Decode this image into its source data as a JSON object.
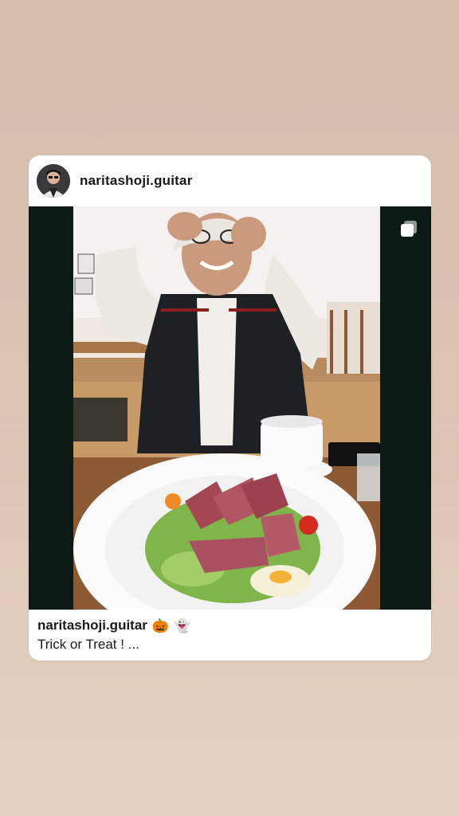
{
  "post": {
    "username": "naritashoji.guitar",
    "caption": {
      "username": "naritashoji.guitar",
      "emojis": [
        "🎃",
        "👻"
      ],
      "text": "Trick or Treat ! ..."
    },
    "icons": {
      "avatar": "profile-avatar",
      "multi": "multiple-images-icon"
    },
    "colors": {
      "card": "#ffffff",
      "media_bg": "#0b1a14",
      "background": "#dcc4b3"
    }
  }
}
